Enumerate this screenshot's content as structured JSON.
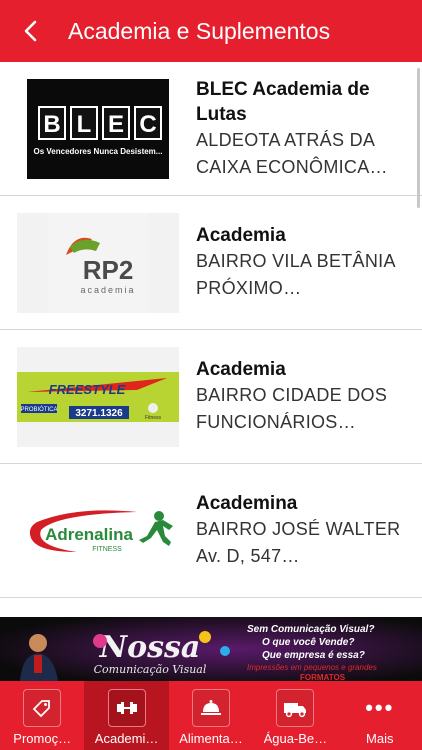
{
  "header": {
    "title": "Academia e Suplementos"
  },
  "items": [
    {
      "title": "BLEC Academia de Lutas",
      "subtitle": "ALDEOTA ATRÁS DA CAIXA ECONÔMICA…",
      "logo_text": "BLEC",
      "logo_tagline": "Os Vencedores Nunca Desistem..."
    },
    {
      "title": "Academia",
      "subtitle": "BAIRRO VILA BETÂNIA PRÓXIMO…",
      "logo_text": "RP2",
      "logo_tagline": "academia"
    },
    {
      "title": "Academia",
      "subtitle": "BAIRRO CIDADE DOS FUNCIONÁRIOS…",
      "logo_text": "FREESTYLE",
      "logo_tagline": "PROBIÓTICA",
      "logo_phone": "3271.1326",
      "logo_small": "Fitness"
    },
    {
      "title": "Academina",
      "subtitle": "BAIRRO JOSÉ WALTER Av. D, 547…",
      "logo_text": "Adrenalina",
      "logo_tagline": "FITNESS"
    }
  ],
  "banner": {
    "brand": "Nossa",
    "brand_sub": "Comunicação Visual",
    "line1": "Sem Comunicação Visual?",
    "line2": "O que você Vende?",
    "line3": "Que empresa é essa?",
    "line4": "Impressões em pequenos e grandes",
    "line5": "FORMATOS"
  },
  "tabs": [
    {
      "label": "Promoç…",
      "icon": "tag-icon"
    },
    {
      "label": "Academi…",
      "icon": "dumbbell-icon",
      "active": true
    },
    {
      "label": "Alimenta…",
      "icon": "food-cloche-icon"
    },
    {
      "label": "Água-Be…",
      "icon": "delivery-truck-icon"
    },
    {
      "label": "Mais",
      "icon": "more-dots-icon"
    }
  ],
  "colors": {
    "brand_red": "#e51f2d",
    "active_tab": "#b81521"
  }
}
